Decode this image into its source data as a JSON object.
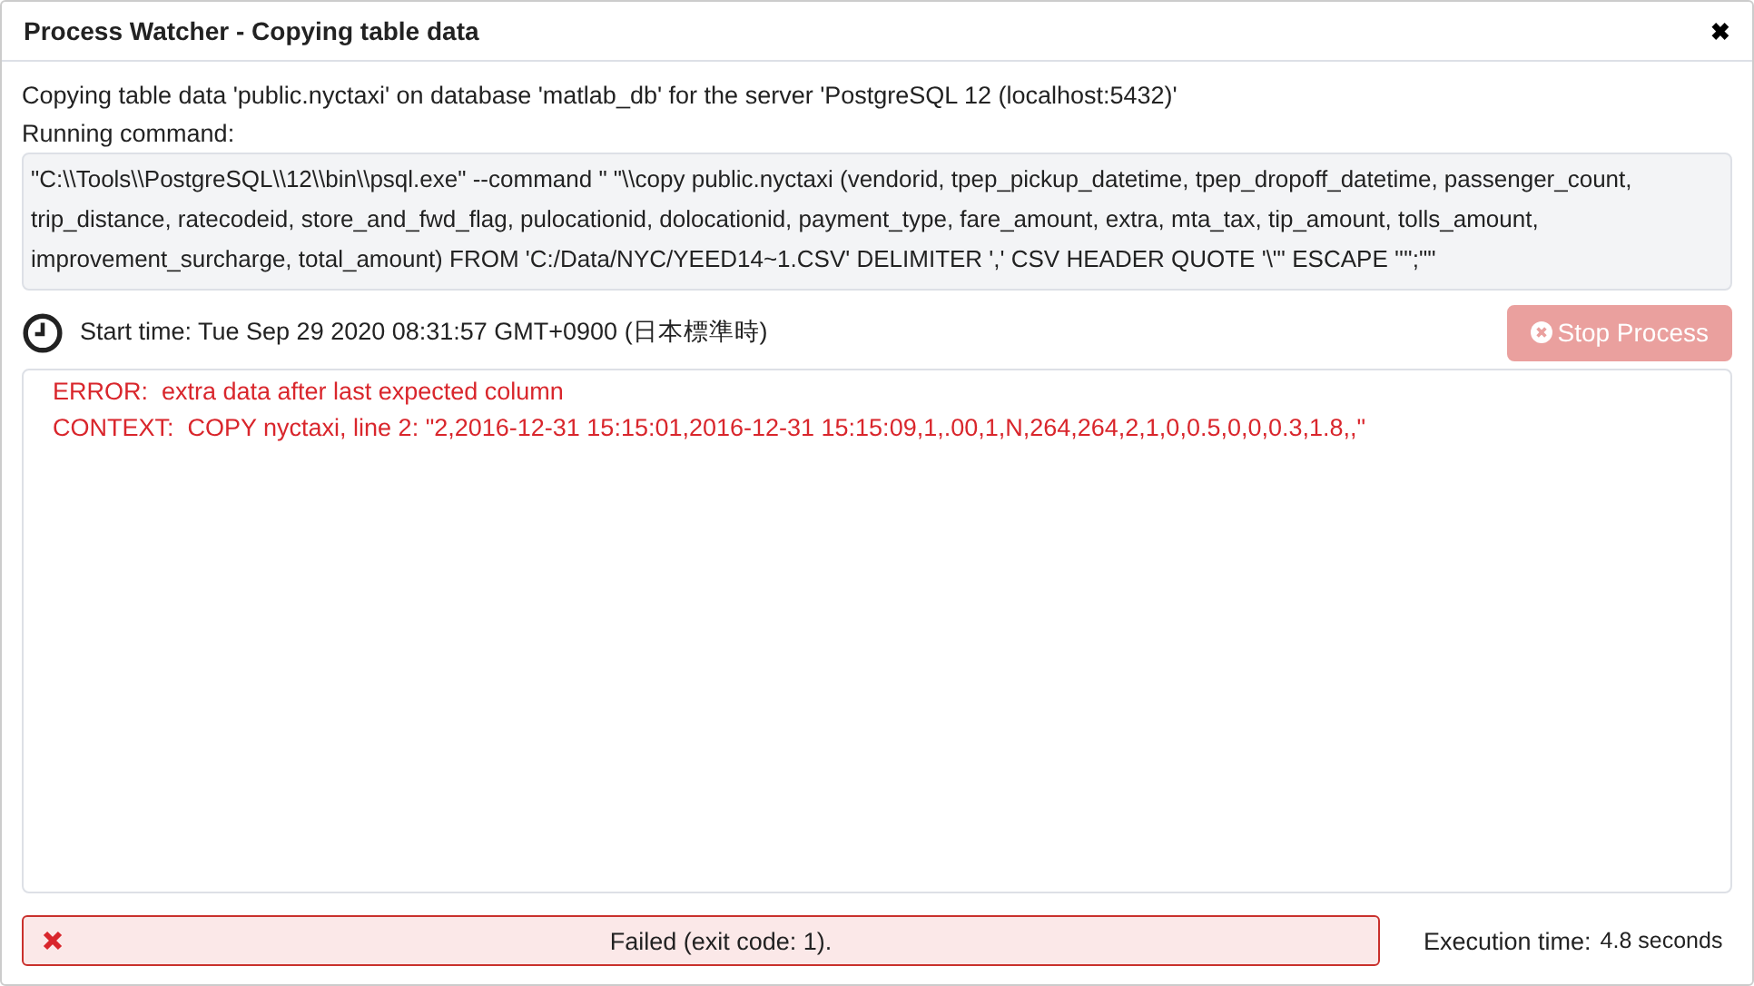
{
  "window": {
    "title": "Process Watcher - Copying table data",
    "close": "✖"
  },
  "description": "Copying table data 'public.nyctaxi' on database 'matlab_db' for the server 'PostgreSQL 12 (localhost:5432)'",
  "command_label": "Running command:",
  "command": "\"C:\\\\Tools\\\\PostgreSQL\\\\12\\\\bin\\\\psql.exe\" --command \" \"\\\\copy public.nyctaxi (vendorid, tpep_pickup_datetime, tpep_dropoff_datetime, passenger_count, trip_distance, ratecodeid, store_and_fwd_flag, pulocationid, dolocationid, payment_type, fare_amount, extra, mta_tax, tip_amount, tolls_amount, improvement_surcharge, total_amount) FROM 'C:/Data/NYC/YEED14~1.CSV' DELIMITER ',' CSV HEADER QUOTE '\\\"' ESCAPE '''';\"\"",
  "start_time": "Start time: Tue Sep 29 2020 08:31:57 GMT+0900 (日本標準時)",
  "stop_button": {
    "label": "Stop Process",
    "disabled": true
  },
  "output": [
    {
      "text": "ERROR:  extra data after last expected column",
      "kind": "error"
    },
    {
      "text": "CONTEXT:  COPY nyctaxi, line 2: \"2,2016-12-31 15:15:01,2016-12-31 15:15:09,1,.00,1,N,264,264,2,1,0,0.5,0,0,0.3,1.8,,\"",
      "kind": "error"
    }
  ],
  "status": {
    "text": "Failed (exit code: 1).",
    "kind": "failed"
  },
  "execution_time": {
    "label": "Execution time:",
    "value": "4.8 seconds"
  }
}
